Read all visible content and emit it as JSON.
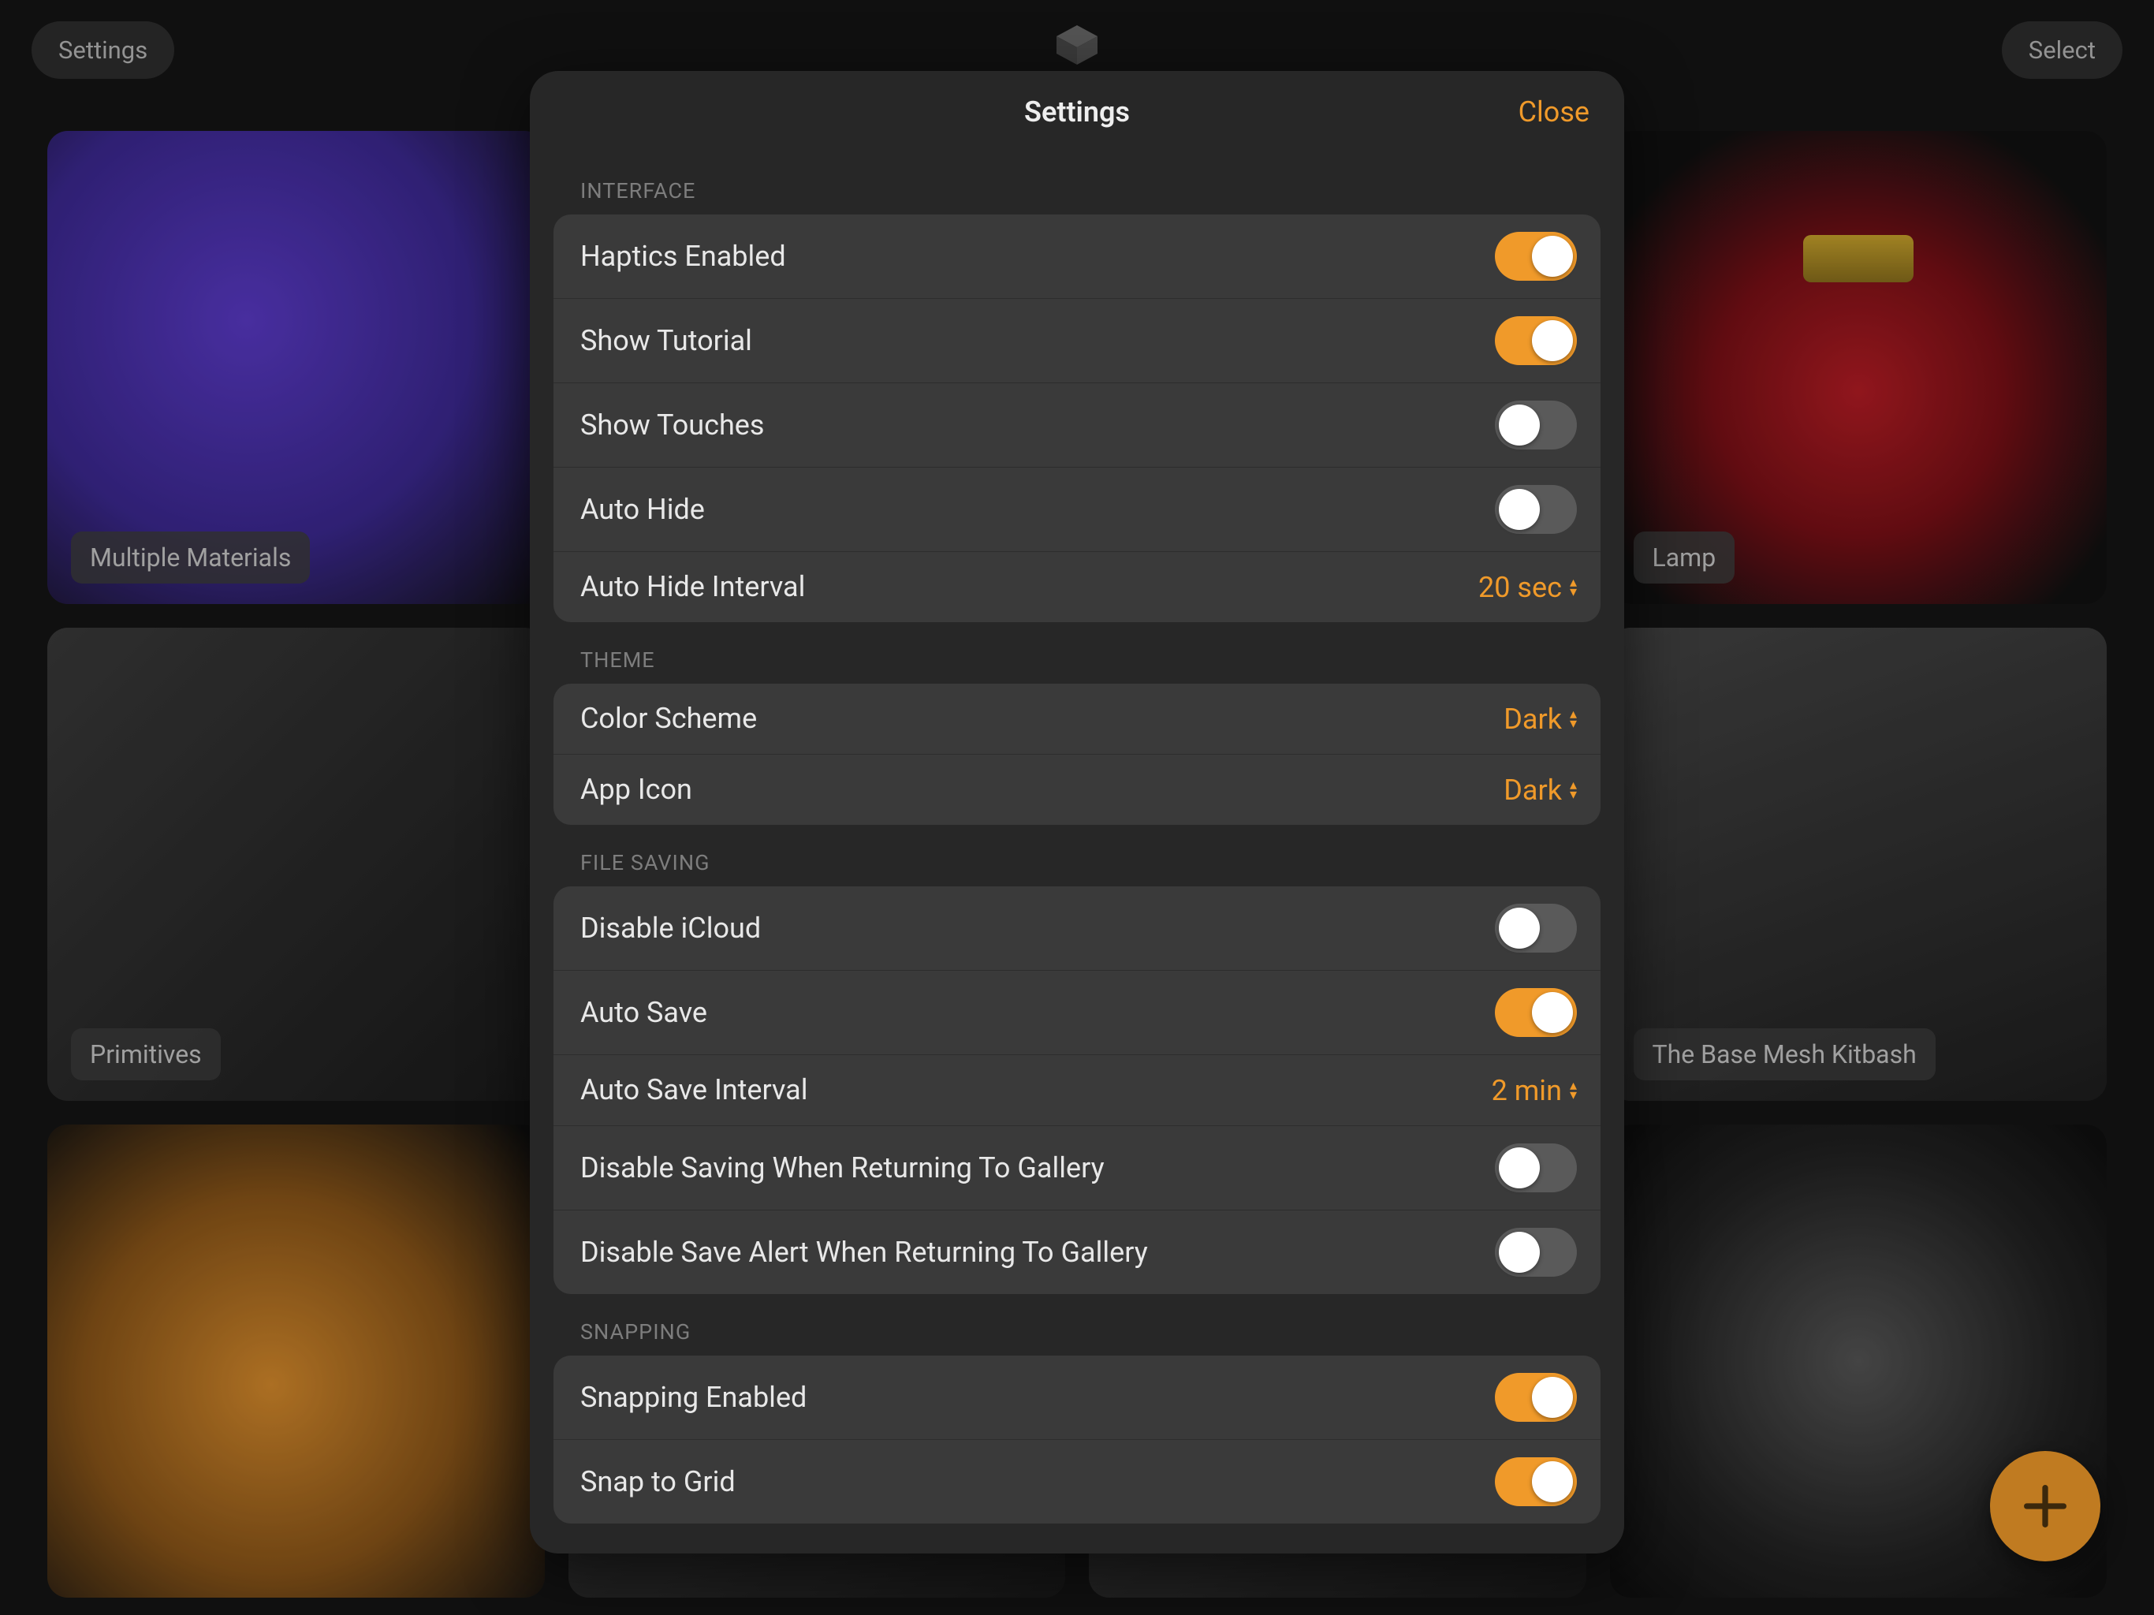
{
  "topbar": {
    "settings": "Settings",
    "select": "Select"
  },
  "gallery": {
    "cards": [
      {
        "label": "Multiple Materials"
      },
      {
        "label": ""
      },
      {
        "label": ""
      },
      {
        "label": "Lamp"
      },
      {
        "label": "Primitives"
      },
      {
        "label": ""
      },
      {
        "label": ""
      },
      {
        "label": "The Base Mesh Kitbash"
      },
      {
        "label": ""
      },
      {
        "label": ""
      },
      {
        "label": ""
      },
      {
        "label": ""
      }
    ]
  },
  "modal": {
    "title": "Settings",
    "close": "Close",
    "sections": {
      "interface": {
        "header": "INTERFACE",
        "haptics": {
          "label": "Haptics Enabled",
          "on": true
        },
        "tutorial": {
          "label": "Show Tutorial",
          "on": true
        },
        "touches": {
          "label": "Show Touches",
          "on": false
        },
        "autohide": {
          "label": "Auto Hide",
          "on": false
        },
        "interval": {
          "label": "Auto Hide Interval",
          "value": "20 sec"
        }
      },
      "theme": {
        "header": "THEME",
        "scheme": {
          "label": "Color Scheme",
          "value": "Dark"
        },
        "icon": {
          "label": "App Icon",
          "value": "Dark"
        }
      },
      "saving": {
        "header": "FILE SAVING",
        "icloud": {
          "label": "Disable iCloud",
          "on": false
        },
        "autosave": {
          "label": "Auto Save",
          "on": true
        },
        "interval": {
          "label": "Auto Save Interval",
          "value": "2 min"
        },
        "disablesave": {
          "label": "Disable Saving When Returning To Gallery",
          "on": false
        },
        "disablealert": {
          "label": "Disable Save Alert When Returning To Gallery",
          "on": false
        }
      },
      "snapping": {
        "header": "SNAPPING",
        "enabled": {
          "label": "Snapping Enabled",
          "on": true
        },
        "grid": {
          "label": "Snap to Grid",
          "on": true
        }
      }
    }
  }
}
